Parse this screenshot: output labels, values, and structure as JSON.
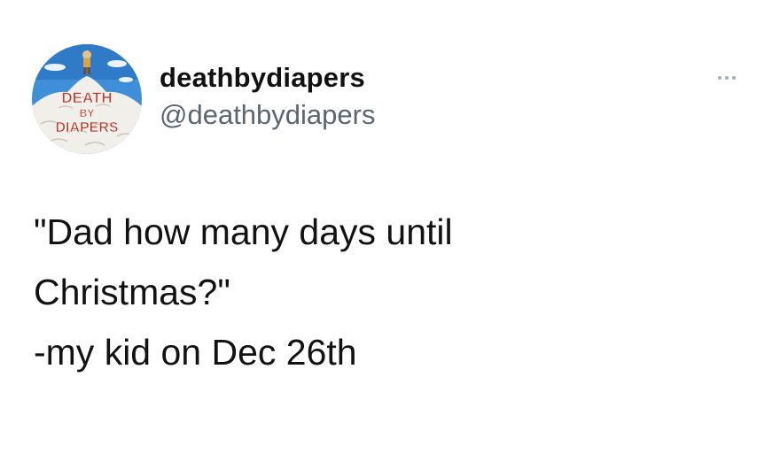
{
  "user": {
    "display_name": "deathbydiapers",
    "handle": "@deathbydiapers",
    "avatar_logo_text": "DEATH BY DIAPERS"
  },
  "tweet": {
    "lines": [
      "\"Dad how many days until",
      "Christmas?\"",
      "-my kid on Dec 26th"
    ]
  },
  "icons": {
    "more": "more-horizontal-icon"
  },
  "colors": {
    "background": "#ffffff",
    "text": "#121212",
    "handle": "#5b6670",
    "menu_dots": "#a8b0b8",
    "avatar_sky": "#3f8fd8",
    "avatar_text": "#c0392b"
  }
}
